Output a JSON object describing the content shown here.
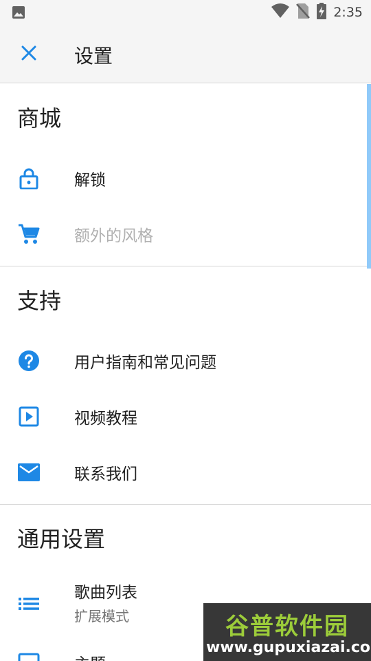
{
  "status_bar": {
    "time": "2:35",
    "icons": [
      "image-icon",
      "wifi-icon",
      "no-sim-icon",
      "battery-charging-icon"
    ]
  },
  "app_bar": {
    "title": "设置",
    "close_icon": "close-icon"
  },
  "sections": [
    {
      "title": "商城",
      "items": [
        {
          "label": "解锁",
          "icon": "lock-icon",
          "enabled": true
        },
        {
          "label": "额外的风格",
          "icon": "cart-icon",
          "enabled": false
        }
      ]
    },
    {
      "title": "支持",
      "items": [
        {
          "label": "用户指南和常见问题",
          "icon": "help-icon",
          "enabled": true
        },
        {
          "label": "视频教程",
          "icon": "video-icon",
          "enabled": true
        },
        {
          "label": "联系我们",
          "icon": "mail-icon",
          "enabled": true
        }
      ]
    },
    {
      "title": "通用设置",
      "items": [
        {
          "label": "歌曲列表",
          "sublabel": "扩展模式",
          "icon": "list-icon",
          "enabled": true
        },
        {
          "label": "主题",
          "icon": "theme-icon",
          "enabled": true
        }
      ]
    }
  ],
  "watermark": {
    "title": "谷普软件园",
    "url": "www.gupuxiazai.com"
  },
  "colors": {
    "accent": "#1e88e5",
    "disabled": "#b0b0b0",
    "bar_bg": "#f5f5f5"
  }
}
